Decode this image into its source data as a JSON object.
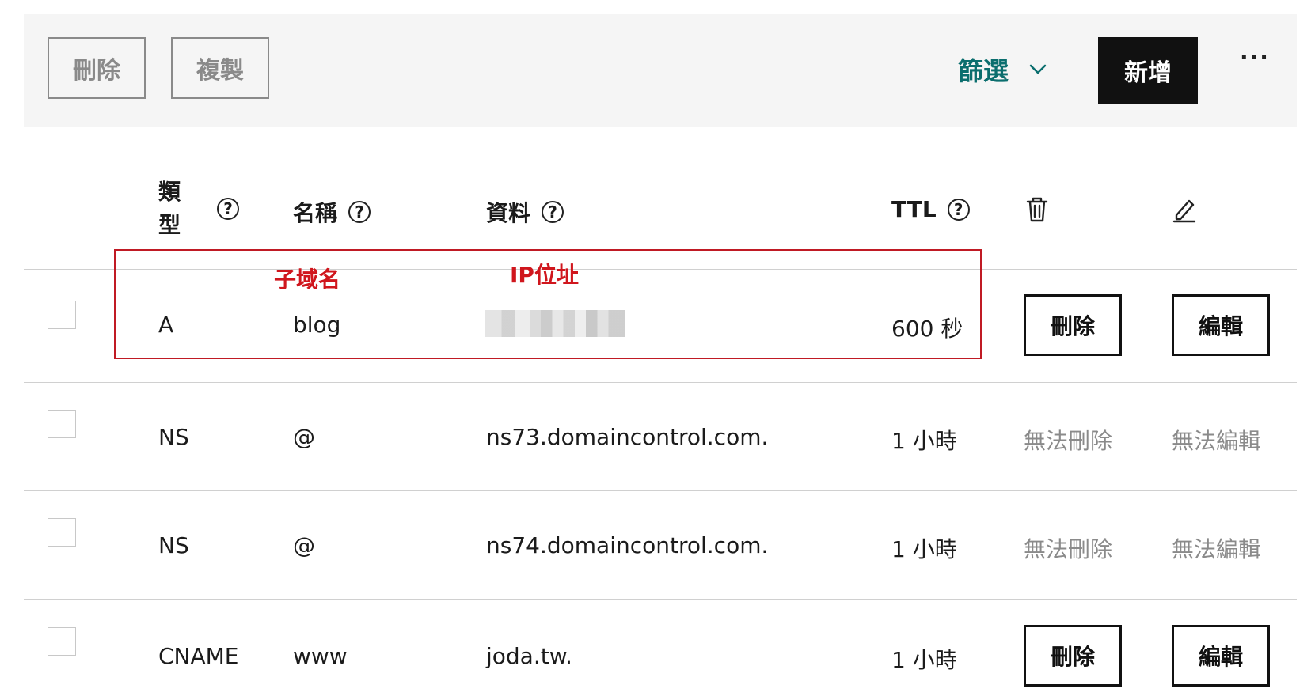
{
  "toolbar": {
    "delete_label": "刪除",
    "copy_label": "複製",
    "filter_label": "篩選",
    "add_label": "新增",
    "more_label": "···"
  },
  "table": {
    "headers": {
      "type": "類\n型",
      "name": "名稱",
      "data": "資料",
      "ttl": "TTL"
    },
    "rows": [
      {
        "type": "A",
        "name": "blog",
        "data": "",
        "ttl": "600 秒",
        "delete": "刪除",
        "edit": "編輯",
        "editable": true
      },
      {
        "type": "NS",
        "name": "@",
        "data": "ns73.domaincontrol.com.",
        "ttl": "1 小時",
        "delete": "無法刪除",
        "edit": "無法編輯",
        "editable": false
      },
      {
        "type": "NS",
        "name": "@",
        "data": "ns74.domaincontrol.com.",
        "ttl": "1 小時",
        "delete": "無法刪除",
        "edit": "無法編輯",
        "editable": false
      },
      {
        "type": "CNAME",
        "name": "www",
        "data": "joda.tw.",
        "ttl": "1 小時",
        "delete": "刪除",
        "edit": "編輯",
        "editable": true
      }
    ]
  },
  "annotations": {
    "subdomain": "子域名",
    "ip": "IP位址",
    "color": "#d0161d"
  }
}
